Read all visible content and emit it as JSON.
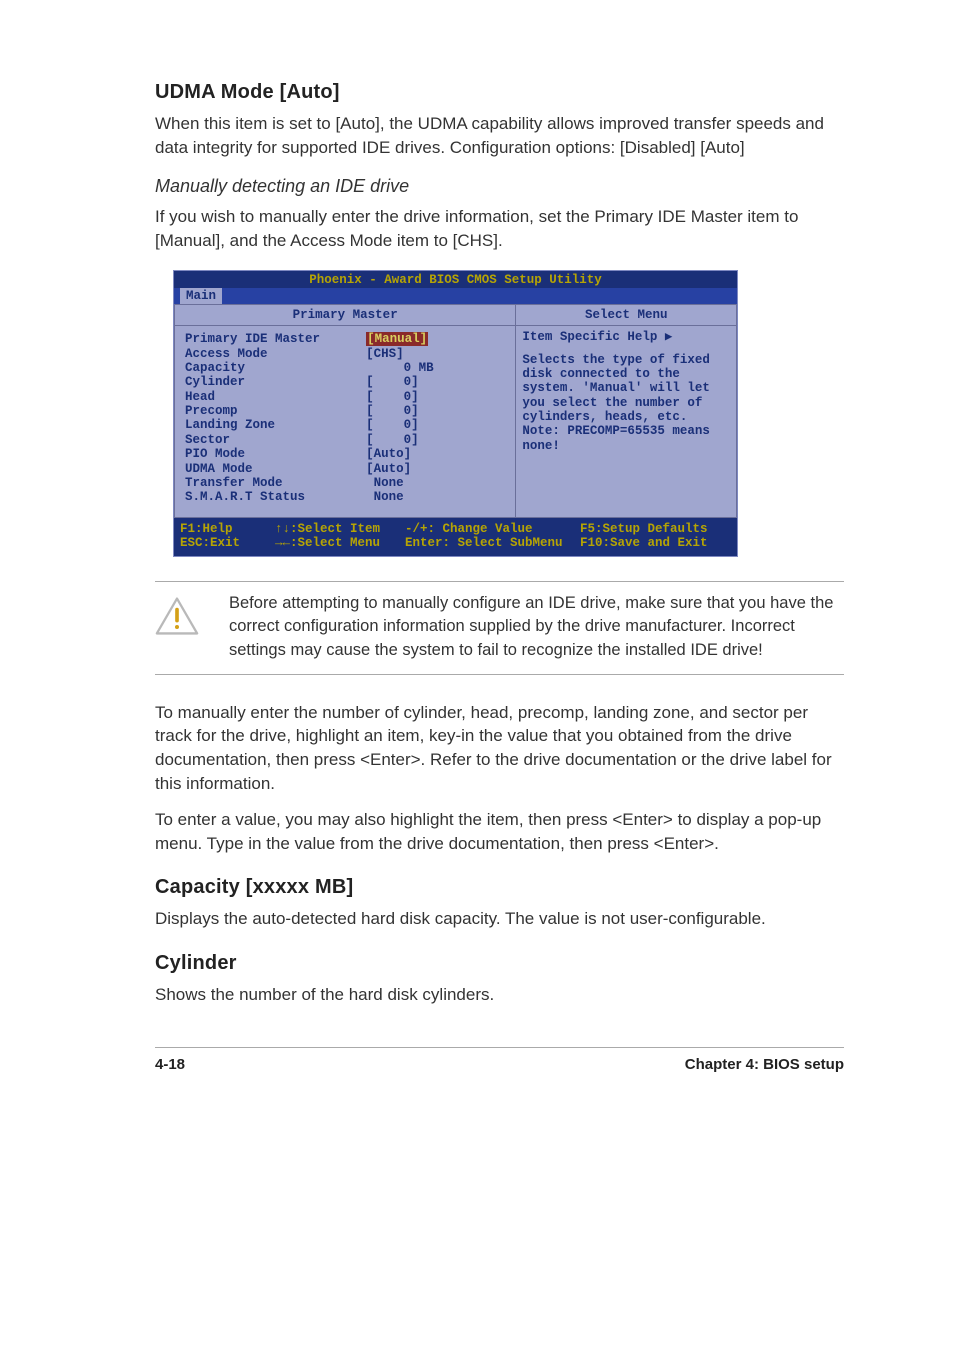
{
  "section1": {
    "heading": "UDMA Mode [Auto]",
    "body": "When this item is set to [Auto], the UDMA capability allows improved transfer speeds and data integrity for supported IDE drives. Configuration options: [Disabled] [Auto]"
  },
  "subheading": "Manually detecting an IDE drive",
  "sub_body": "If you wish to manually enter the drive information, set the Primary IDE Master item to [Manual], and the Access Mode item to [CHS].",
  "bios": {
    "title": "Phoenix - Award BIOS CMOS Setup Utility",
    "tab": "Main",
    "left_header": "Primary Master",
    "right_header": "Select Menu",
    "rows": [
      {
        "label": "Primary IDE Master",
        "value": "[Manual]",
        "hl": true
      },
      {
        "label": "Access Mode",
        "value": "[CHS]"
      },
      {
        "label": "",
        "value": ""
      },
      {
        "label": "Capacity",
        "value": "     0 MB"
      },
      {
        "label": "",
        "value": ""
      },
      {
        "label": "Cylinder",
        "value": "[    0]"
      },
      {
        "label": "Head",
        "value": "[    0]"
      },
      {
        "label": "Precomp",
        "value": "[    0]"
      },
      {
        "label": "Landing Zone",
        "value": "[    0]"
      },
      {
        "label": "Sector",
        "value": "[    0]"
      },
      {
        "label": "PIO Mode",
        "value": "[Auto]"
      },
      {
        "label": "UDMA Mode",
        "value": "[Auto]"
      },
      {
        "label": "Transfer Mode",
        "value": " None"
      },
      {
        "label": "S.M.A.R.T Status",
        "value": " None"
      }
    ],
    "help_title": "Item Specific Help  ▶",
    "help_text": "Selects the type of fixed disk connected to the system. 'Manual' will let you select the number of cylinders, heads, etc.\nNote: PRECOMP=65535 means none!",
    "footer": {
      "r1c1": "F1:Help",
      "r1c2": "↑↓:Select Item",
      "r1c3": "-/+: Change Value",
      "r1c4": "F5:Setup Defaults",
      "r2c1": "ESC:Exit",
      "r2c2": "→←:Select Menu",
      "r2c3": "Enter: Select SubMenu",
      "r2c4": "F10:Save and Exit"
    }
  },
  "note": "Before attempting to manually configure an IDE drive, make sure that you have the correct configuration information supplied by the drive manufacturer. Incorrect settings may cause the system to fail to recognize the installed IDE drive!",
  "para2": "To manually enter the number of cylinder, head, precomp, landing zone, and sector per track for the drive, highlight an item, key-in the value that you obtained from the drive documentation, then press <Enter>. Refer to the drive documentation or the drive label for this information.",
  "para3": "To enter a value, you may also highlight the item, then press <Enter> to display a pop-up menu. Type in the value from the drive documentation, then press <Enter>.",
  "section2": {
    "heading": "Capacity [xxxxx MB]",
    "body": "Displays the auto-detected hard disk capacity. The value is not user-configurable."
  },
  "section3": {
    "heading": "Cylinder",
    "body": "Shows the number of the hard disk cylinders."
  },
  "footer": {
    "left": "4-18",
    "right": "Chapter 4: BIOS setup"
  },
  "chart_data": {
    "type": "table",
    "title": "Primary Master — BIOS CMOS settings",
    "rows": [
      {
        "item": "Primary IDE Master",
        "value": "Manual"
      },
      {
        "item": "Access Mode",
        "value": "CHS"
      },
      {
        "item": "Capacity",
        "value": "0 MB"
      },
      {
        "item": "Cylinder",
        "value": 0
      },
      {
        "item": "Head",
        "value": 0
      },
      {
        "item": "Precomp",
        "value": 0
      },
      {
        "item": "Landing Zone",
        "value": 0
      },
      {
        "item": "Sector",
        "value": 0
      },
      {
        "item": "PIO Mode",
        "value": "Auto"
      },
      {
        "item": "UDMA Mode",
        "value": "Auto"
      },
      {
        "item": "Transfer Mode",
        "value": "None"
      },
      {
        "item": "S.M.A.R.T Status",
        "value": "None"
      }
    ]
  }
}
